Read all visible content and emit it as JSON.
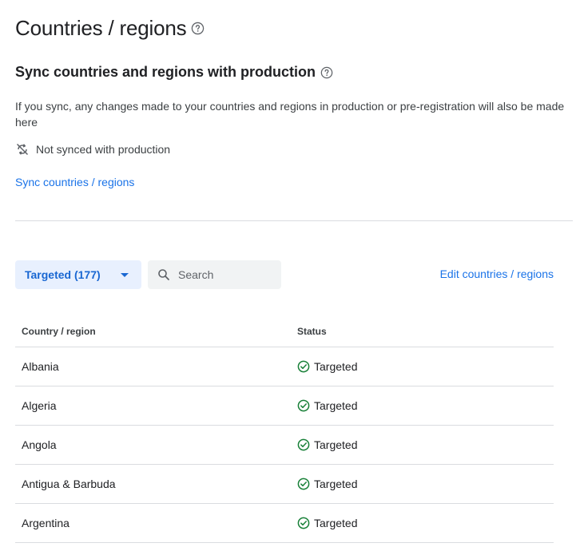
{
  "page": {
    "title": "Countries / regions"
  },
  "sync": {
    "heading": "Sync countries and regions with production",
    "description": "If you sync, any changes made to your countries and regions in production or pre-registration will also be made here",
    "status_text": "Not synced with production",
    "link_label": "Sync countries / regions"
  },
  "toolbar": {
    "filter_label": "Targeted (177)",
    "search_placeholder": "Search",
    "edit_label": "Edit countries / regions"
  },
  "table": {
    "headers": {
      "country": "Country / region",
      "status": "Status"
    },
    "rows": [
      {
        "country": "Albania",
        "status": "Targeted"
      },
      {
        "country": "Algeria",
        "status": "Targeted"
      },
      {
        "country": "Angola",
        "status": "Targeted"
      },
      {
        "country": "Antigua & Barbuda",
        "status": "Targeted"
      },
      {
        "country": "Argentina",
        "status": "Targeted"
      }
    ]
  },
  "colors": {
    "link": "#1a73e8",
    "chip_bg": "#e8f0fe",
    "chip_text": "#1967d2",
    "success": "#188038",
    "divider": "#dadce0"
  },
  "icons": {
    "help": "help-circle-icon",
    "sync_off": "sync-disabled-icon",
    "dropdown": "caret-down-icon",
    "search": "search-icon",
    "status": "check-circle-icon"
  }
}
